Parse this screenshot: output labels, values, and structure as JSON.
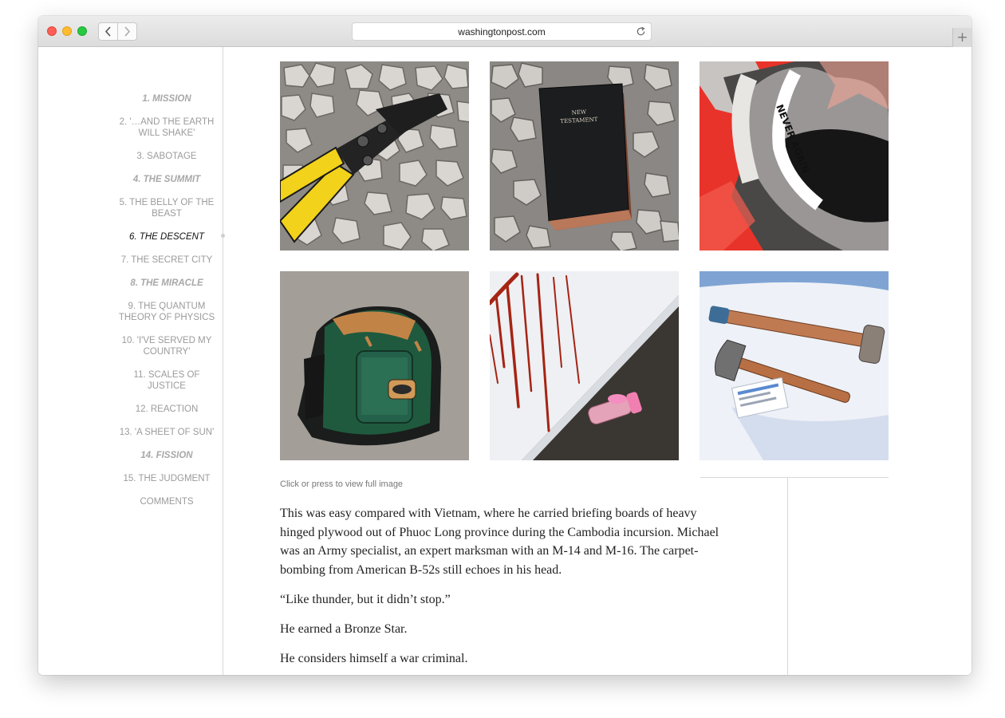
{
  "browser": {
    "url": "washingtonpost.com",
    "new_tab_label": "+"
  },
  "toc": {
    "items": [
      {
        "label": "1. MISSION",
        "style": "ital"
      },
      {
        "label": "2. '…AND THE EARTH WILL SHAKE'",
        "style": "plain"
      },
      {
        "label": "3. SABOTAGE",
        "style": "plain"
      },
      {
        "label": "4. THE SUMMIT",
        "style": "ital"
      },
      {
        "label": "5. THE BELLY OF THE BEAST",
        "style": "plain"
      },
      {
        "label": "6. THE DESCENT",
        "style": "active"
      },
      {
        "label": "7. THE SECRET CITY",
        "style": "plain"
      },
      {
        "label": "8. THE MIRACLE",
        "style": "ital"
      },
      {
        "label": "9. THE QUANTUM THEORY OF PHYSICS",
        "style": "plain"
      },
      {
        "label": "10. 'I'VE SERVED MY COUNTRY'",
        "style": "plain"
      },
      {
        "label": "11. SCALES OF JUSTICE",
        "style": "plain"
      },
      {
        "label": "12. REACTION",
        "style": "plain"
      },
      {
        "label": "13. 'A SHEET OF SUN'",
        "style": "plain"
      },
      {
        "label": "14. FISSION",
        "style": "ital"
      },
      {
        "label": "15. THE JUDGMENT",
        "style": "plain"
      },
      {
        "label": "COMMENTS",
        "style": "plain"
      }
    ]
  },
  "gallery": {
    "photos": [
      {
        "subject": "bolt-cutters"
      },
      {
        "subject": "new-testament",
        "book_text_1": "NEW",
        "book_text_2": "TESTAMENT"
      },
      {
        "subject": "never-again-banner",
        "banner_text": "NEVER AGAIN"
      },
      {
        "subject": "backpack"
      },
      {
        "subject": "blood-vial"
      },
      {
        "subject": "hammers"
      }
    ],
    "caption": "Click or press to view full image"
  },
  "article": {
    "paragraphs": [
      "This was easy compared with Vietnam, where he carried briefing boards of heavy hinged plywood out of Phuoc Long province during the Cambodia incursion. Michael was an Army specialist, an expert marksman with an M-14 and M-16. The carpet-bombing from American B-52s still echoes in his head.",
      "“Like thunder, but it didn’t stop.”",
      "He earned a Bronze Star.",
      "He considers himself a war criminal."
    ]
  },
  "colors": {
    "accent_red": "#e8332a",
    "bolt_cutter_yellow": "#f2d21a",
    "backpack_green": "#1f5a3e"
  }
}
